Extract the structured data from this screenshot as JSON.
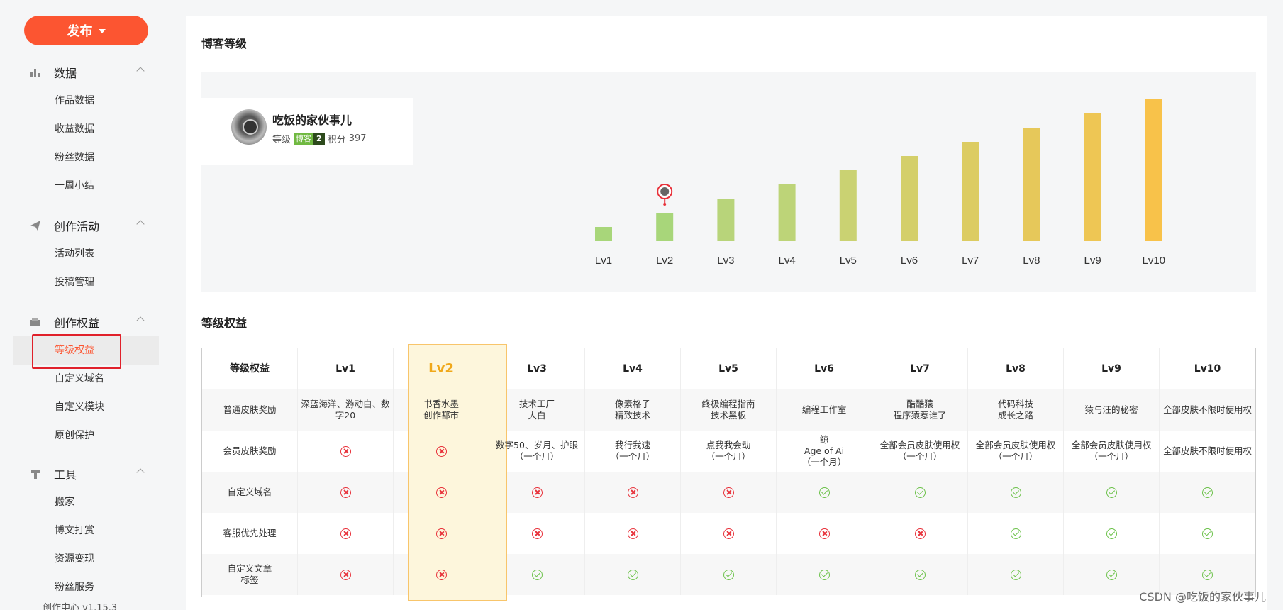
{
  "sidebar": {
    "publish_label": "发布",
    "groups": [
      {
        "title": "数据",
        "icon": "bar-chart-icon",
        "items": [
          "作品数据",
          "收益数据",
          "粉丝数据",
          "一周小结"
        ]
      },
      {
        "title": "创作活动",
        "icon": "paper-plane-icon",
        "items": [
          "活动列表",
          "投稿管理"
        ]
      },
      {
        "title": "创作权益",
        "icon": "wallet-icon",
        "items": [
          "等级权益",
          "自定义域名",
          "自定义模块",
          "原创保护"
        ]
      },
      {
        "title": "工具",
        "icon": "tool-icon",
        "items": [
          "搬家",
          "博文打赏",
          "资源变现",
          "粉丝服务"
        ]
      }
    ],
    "active_item": "等级权益",
    "version": "创作中心 v1.15.3"
  },
  "blog_level": {
    "title": "博客等级",
    "user": {
      "name": "吃饭的家伙事儿",
      "level_label": "等级",
      "badge_text": "博客",
      "badge_level": "2",
      "points_label": "积分",
      "points": "397"
    },
    "current_level": "Lv2"
  },
  "chart_data": {
    "type": "bar",
    "categories": [
      "Lv1",
      "Lv2",
      "Lv3",
      "Lv4",
      "Lv5",
      "Lv6",
      "Lv7",
      "Lv8",
      "Lv9",
      "Lv10"
    ],
    "values": [
      1,
      2,
      3,
      4,
      5,
      6,
      7,
      8,
      9,
      10
    ],
    "colors": [
      "#a8d67a",
      "#a8d67a",
      "#b8d47a",
      "#bdd478",
      "#cad272",
      "#d4cf6a",
      "#dccc62",
      "#e6c85a",
      "#eec654",
      "#f8c24a"
    ],
    "title": "",
    "xlabel": "",
    "ylabel": ""
  },
  "benefits": {
    "title": "等级权益",
    "columns": [
      "等级权益",
      "Lv1",
      "Lv2",
      "Lv3",
      "Lv4",
      "Lv5",
      "Lv6",
      "Lv7",
      "Lv8",
      "Lv9",
      "Lv10"
    ],
    "rows": [
      {
        "label": "普通皮肤奖励",
        "cells": [
          "深蓝海洋、游动白、数字20",
          "书香水墨\n创作都市",
          "技术工厂\n大白",
          "像素格子\n精致技术",
          "终极编程指南\n技术黑板",
          "编程工作室",
          "酷酷猿\n程序猿惹谁了",
          "代码科技\n成长之路",
          "猿与汪的秘密",
          "全部皮肤不限时使用权"
        ]
      },
      {
        "label": "会员皮肤奖励",
        "cells": [
          "no",
          "no",
          "数字50、岁月、护眼\n（一个月）",
          "我行我速\n（一个月）",
          "点我我会动\n（一个月）",
          "鲸\nAge of Ai\n（一个月）",
          "全部会员皮肤使用权\n（一个月）",
          "全部会员皮肤使用权\n（一个月）",
          "全部会员皮肤使用权\n（一个月）",
          "全部皮肤不限时使用权"
        ]
      },
      {
        "label": "自定义域名",
        "cells": [
          "no",
          "no",
          "no",
          "no",
          "no",
          "ok",
          "ok",
          "ok",
          "ok",
          "ok"
        ]
      },
      {
        "label": "客服优先处理",
        "cells": [
          "no",
          "no",
          "no",
          "no",
          "no",
          "no",
          "no",
          "ok",
          "ok",
          "ok"
        ]
      },
      {
        "label": "自定义文章\n标签",
        "cells": [
          "no",
          "no",
          "ok",
          "ok",
          "ok",
          "ok",
          "ok",
          "ok",
          "ok",
          "ok"
        ]
      }
    ]
  },
  "watermark": "CSDN @吃饭的家伙事儿"
}
